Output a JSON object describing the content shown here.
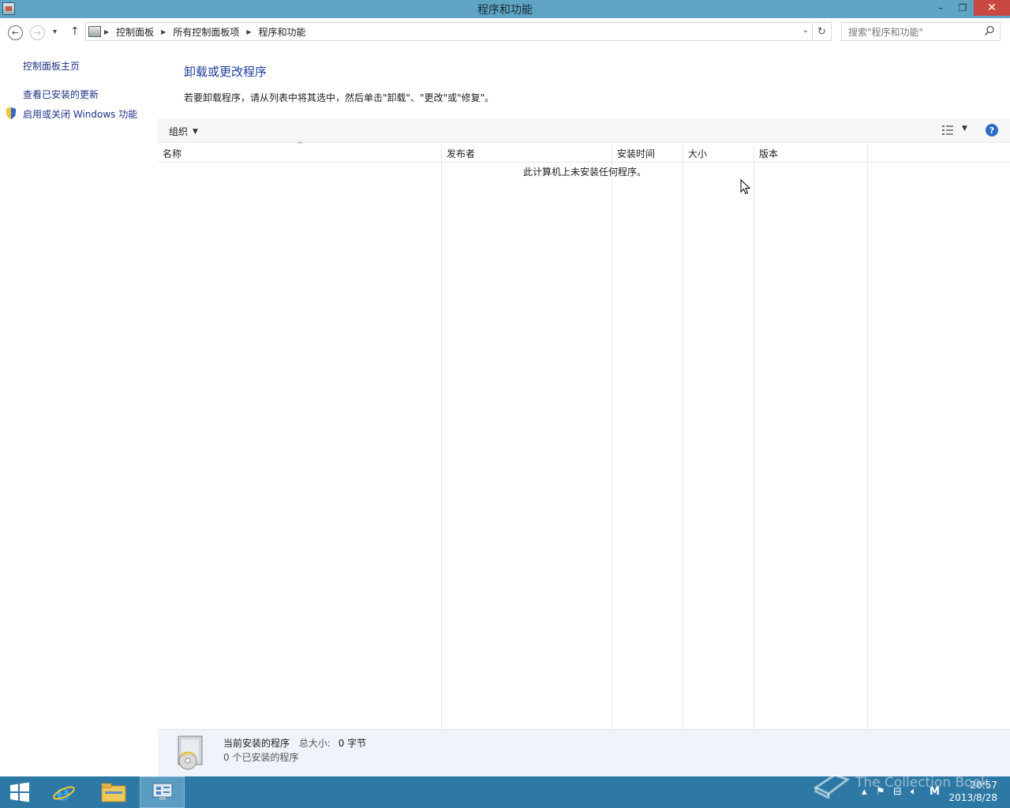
{
  "window": {
    "title": "程序和功能",
    "minimize": "–",
    "restore": "❐",
    "close": "✕"
  },
  "nav": {
    "back": "←",
    "forward": "→",
    "recent": "▾",
    "up": "↑",
    "breadcrumbs": [
      "控制面板",
      "所有控制面板项",
      "程序和功能"
    ],
    "search_placeholder": "搜索\"程序和功能\""
  },
  "sidebar": {
    "items": [
      {
        "label": "控制面板主页"
      },
      {
        "label": "查看已安装的更新"
      },
      {
        "label": "启用或关闭 Windows 功能"
      }
    ]
  },
  "main": {
    "title": "卸载或更改程序",
    "description": "若要卸载程序，请从列表中将其选中，然后单击\"卸载\"、\"更改\"或\"修复\"。",
    "organize": "组织",
    "columns": [
      "名称",
      "发布者",
      "安装时间",
      "大小",
      "版本"
    ],
    "empty_message": "此计算机上未安装任何程序。"
  },
  "details": {
    "title": "当前安装的程序",
    "size_label": "总大小:",
    "size_value": "0 字节",
    "count_text": "0 个已安装的程序"
  },
  "taskbar": {
    "time": "20:57",
    "date": "2013/8/28",
    "watermark": "The Collection Book"
  },
  "colors": {
    "titlebar": "#5fa5c3",
    "taskbar": "#2d78a4",
    "close": "#c74841",
    "link": "#1e3287"
  }
}
